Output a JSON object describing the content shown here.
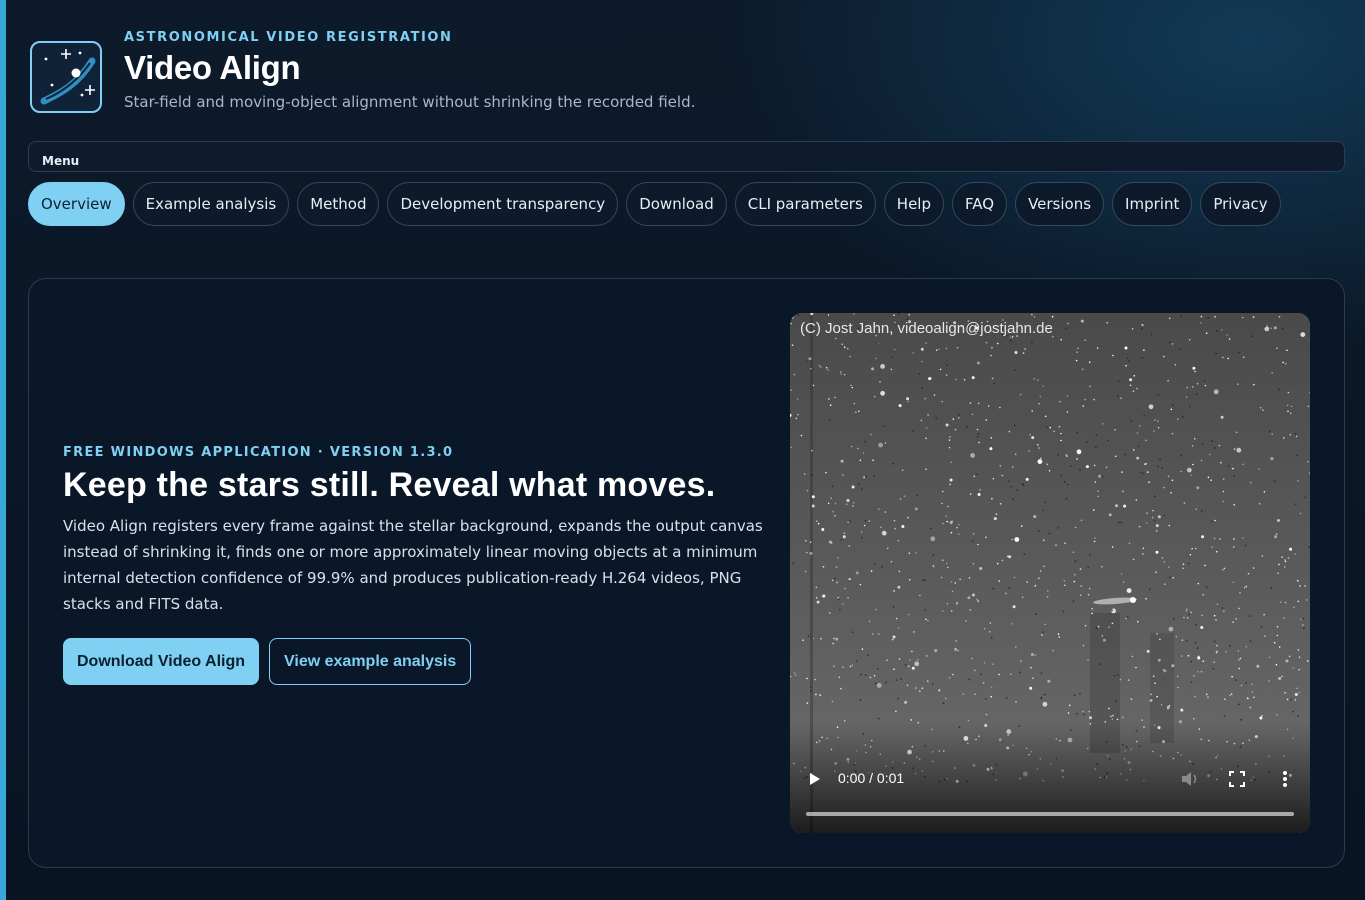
{
  "header": {
    "eyebrow": "ASTRONOMICAL VIDEO REGISTRATION",
    "title": "Video Align",
    "tagline": "Star-field and moving-object alignment without shrinking the recorded field.",
    "logo_icon": "comet-logo-icon"
  },
  "menu": {
    "label": "Menu"
  },
  "nav": {
    "active": "Overview",
    "items": [
      {
        "label": "Overview"
      },
      {
        "label": "Example analysis"
      },
      {
        "label": "Method"
      },
      {
        "label": "Development transparency"
      },
      {
        "label": "Download"
      },
      {
        "label": "CLI parameters"
      },
      {
        "label": "Help"
      },
      {
        "label": "FAQ"
      },
      {
        "label": "Versions"
      },
      {
        "label": "Imprint"
      },
      {
        "label": "Privacy"
      }
    ]
  },
  "hero": {
    "kicker": "FREE WINDOWS APPLICATION · VERSION 1.3.0",
    "headline": "Keep the stars still. Reveal what moves.",
    "lead": "Video Align registers every frame against the stellar background, expands the output canvas instead of shrinking it, finds one or more approximately linear moving objects at a minimum internal detection confidence of 99.9% and produces publication-ready H.264 videos, PNG stacks and FITS data.",
    "primary_button": "Download Video Align",
    "secondary_button": "View example analysis"
  },
  "video": {
    "watermark": "(C) Jost Jahn, videoalign@jostjahn.de",
    "time": "0:00 / 0:01",
    "progress": 0
  },
  "colors": {
    "accent": "#7fd0f2",
    "background": "#0c1a2b",
    "side_bar": "#38a8d8"
  }
}
